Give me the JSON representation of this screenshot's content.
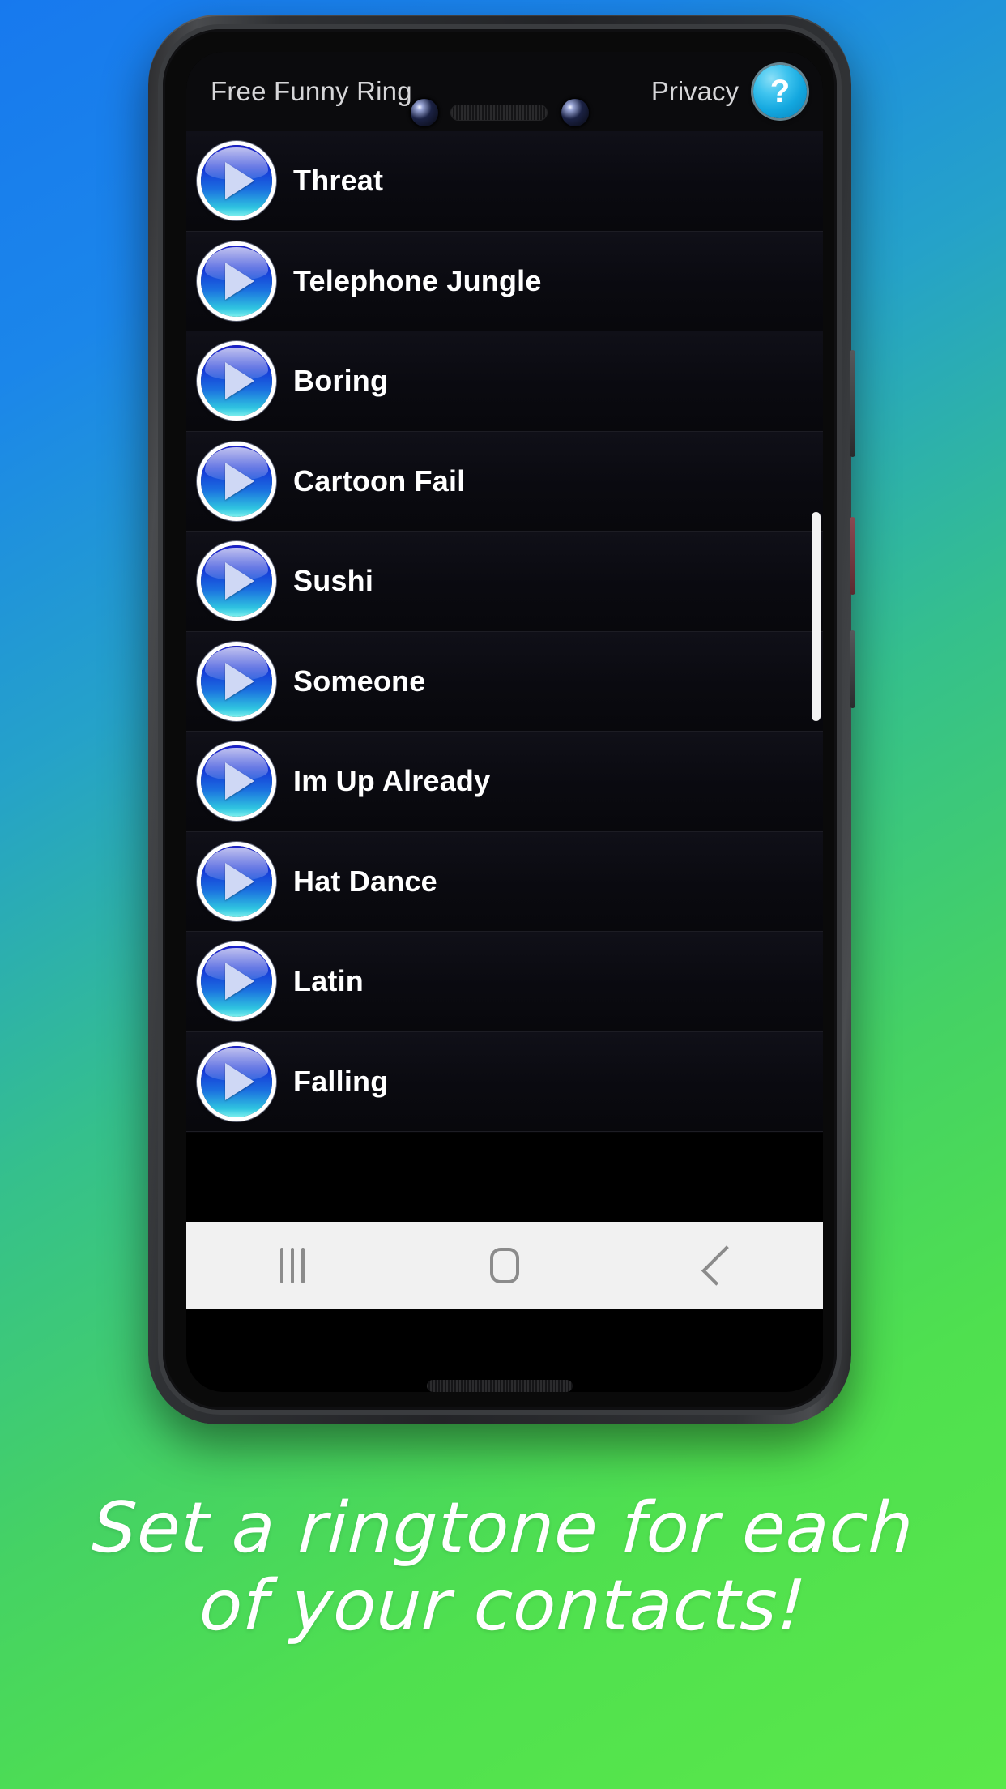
{
  "promo": {
    "background_gradient_from": "#1779ee",
    "background_gradient_to": "#5ae84a",
    "caption_line1": "Set a ringtone for each",
    "caption_line2": "of your contacts!"
  },
  "app": {
    "title": "Free Funny Ring",
    "privacy_label": "Privacy",
    "help_label": "?",
    "accent_color": "#13a7df",
    "play_button_color": "#1430d6",
    "watermark": "android-robot-outline"
  },
  "ringtones": [
    {
      "name": "Threat",
      "play_icon": "play-icon"
    },
    {
      "name": "Telephone Jungle",
      "play_icon": "play-icon"
    },
    {
      "name": "Boring",
      "play_icon": "play-icon"
    },
    {
      "name": "Cartoon Fail",
      "play_icon": "play-icon"
    },
    {
      "name": "Sushi",
      "play_icon": "play-icon"
    },
    {
      "name": "Someone",
      "play_icon": "play-icon"
    },
    {
      "name": "Im Up Already",
      "play_icon": "play-icon"
    },
    {
      "name": "Hat Dance",
      "play_icon": "play-icon"
    },
    {
      "name": "Latin",
      "play_icon": "play-icon"
    },
    {
      "name": "Falling",
      "play_icon": "play-icon"
    }
  ],
  "navbar": {
    "recents_label": "Recents",
    "home_label": "Home",
    "back_label": "Back"
  }
}
